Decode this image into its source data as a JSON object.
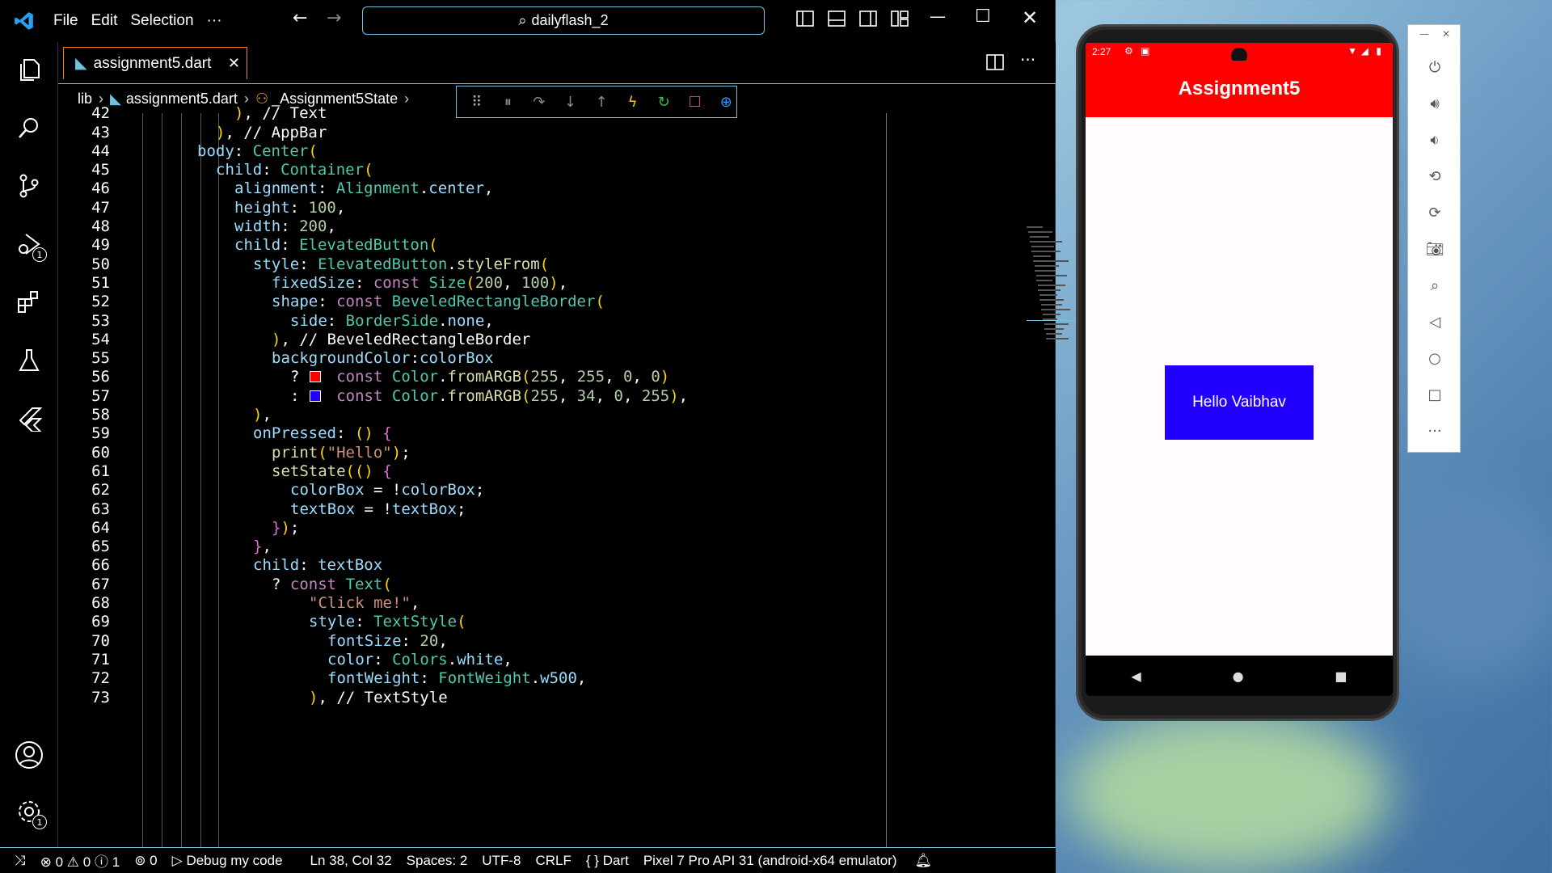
{
  "titlebar": {
    "menu": [
      "File",
      "Edit",
      "Selection",
      "···"
    ],
    "search": "dailyflash_2"
  },
  "tabs": {
    "active": "assignment5.dart"
  },
  "breadcrumb": {
    "folder": "lib",
    "file": "assignment5.dart",
    "symbol": "_Assignment5State"
  },
  "code": {
    "lines": [
      {
        "n": "42",
        "t": "), // Text"
      },
      {
        "n": "43",
        "t": "), // AppBar"
      },
      {
        "n": "44",
        "t": "body: Center("
      },
      {
        "n": "45",
        "t": "child: Container("
      },
      {
        "n": "46",
        "t": "alignment: Alignment.center,"
      },
      {
        "n": "47",
        "t": "height: 100,"
      },
      {
        "n": "48",
        "t": "width: 200,"
      },
      {
        "n": "49",
        "t": "child: ElevatedButton("
      },
      {
        "n": "50",
        "t": "style: ElevatedButton.styleFrom("
      },
      {
        "n": "51",
        "t": "fixedSize: const Size(200, 100),"
      },
      {
        "n": "52",
        "t": "shape: const BeveledRectangleBorder("
      },
      {
        "n": "53",
        "t": "side: BorderSide.none,"
      },
      {
        "n": "54",
        "t": "), // BeveledRectangleBorder"
      },
      {
        "n": "55",
        "t": "backgroundColor:colorBox"
      },
      {
        "n": "56",
        "t": "? const Color.fromARGB(255, 255, 0, 0)"
      },
      {
        "n": "57",
        "t": ": const Color.fromARGB(255, 34, 0, 255),"
      },
      {
        "n": "58",
        "t": "),"
      },
      {
        "n": "59",
        "t": "onPressed: () {"
      },
      {
        "n": "60",
        "t": "print(\"Hello\");"
      },
      {
        "n": "61",
        "t": "setState(() {"
      },
      {
        "n": "62",
        "t": "colorBox = !colorBox;"
      },
      {
        "n": "63",
        "t": "textBox = !textBox;"
      },
      {
        "n": "64",
        "t": "});"
      },
      {
        "n": "65",
        "t": "},"
      },
      {
        "n": "66",
        "t": "child: textBox"
      },
      {
        "n": "67",
        "t": "? const Text("
      },
      {
        "n": "68",
        "t": "\"Click me!\","
      },
      {
        "n": "69",
        "t": "style: TextStyle("
      },
      {
        "n": "70",
        "t": "fontSize: 20,"
      },
      {
        "n": "71",
        "t": "color: Colors.white,"
      },
      {
        "n": "72",
        "t": "fontWeight: FontWeight.w500,"
      },
      {
        "n": "73",
        "t": "), // TextStyle"
      }
    ]
  },
  "statusbar": {
    "remote": "⤨",
    "errors": "0",
    "warnings": "0",
    "info": "1",
    "ports": "0",
    "debug": "Debug my code",
    "position": "Ln 38, Col 32",
    "spaces": "Spaces: 2",
    "encoding": "UTF-8",
    "eol": "CRLF",
    "language": "Dart",
    "device": "Pixel 7 Pro API 31 (android-x64 emulator)"
  },
  "phone": {
    "time": "2:27",
    "app_title": "Assignment5",
    "button_label": "Hello Vaibhav"
  },
  "colors": {
    "appbar": "#ff0000",
    "button": "#2200ff",
    "accent": "#6fc3df",
    "tab_border": "#f38518"
  }
}
